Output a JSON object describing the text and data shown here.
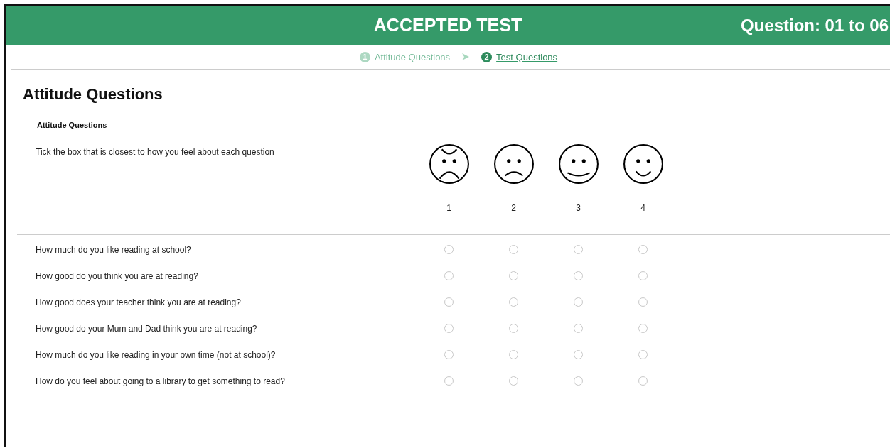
{
  "header": {
    "title": "ACCEPTED TEST",
    "range": "Question: 01 to 06"
  },
  "steps": [
    {
      "number": "1",
      "label": "Attitude Questions",
      "selected": false
    },
    {
      "number": "2",
      "label": "Test Questions",
      "selected": true
    }
  ],
  "page_title": "Attitude Questions",
  "section": {
    "title": "Attitude Questions",
    "instruction": "Tick the box that is closest to how you feel about each question",
    "scale": [
      {
        "kind": "very-sad",
        "label": "1"
      },
      {
        "kind": "sad",
        "label": "2"
      },
      {
        "kind": "happy",
        "label": "3"
      },
      {
        "kind": "very-happy",
        "label": "4"
      }
    ]
  },
  "questions": [
    {
      "text": "How much do you like reading at school?",
      "options": [
        {
          "selected": false
        },
        {
          "selected": false
        },
        {
          "selected": false
        },
        {
          "selected": false
        }
      ]
    },
    {
      "text": "How good do you think you are at reading?",
      "options": [
        {
          "selected": false
        },
        {
          "selected": false
        },
        {
          "selected": false
        },
        {
          "selected": false
        }
      ]
    },
    {
      "text": "How good does your teacher think you are at reading?",
      "options": [
        {
          "selected": false
        },
        {
          "selected": false
        },
        {
          "selected": false
        },
        {
          "selected": false
        }
      ]
    },
    {
      "text": "How good do your Mum and Dad think you are at reading?",
      "options": [
        {
          "selected": false
        },
        {
          "selected": false
        },
        {
          "selected": false
        },
        {
          "selected": false
        }
      ]
    },
    {
      "text": "How much do you like reading in your own time (not at school)?",
      "options": [
        {
          "selected": false
        },
        {
          "selected": false
        },
        {
          "selected": false
        },
        {
          "selected": false
        }
      ]
    },
    {
      "text": "How do you feel about going to a library to get something to read?",
      "options": [
        {
          "selected": false
        },
        {
          "selected": false
        },
        {
          "selected": false
        },
        {
          "selected": false
        }
      ]
    }
  ]
}
